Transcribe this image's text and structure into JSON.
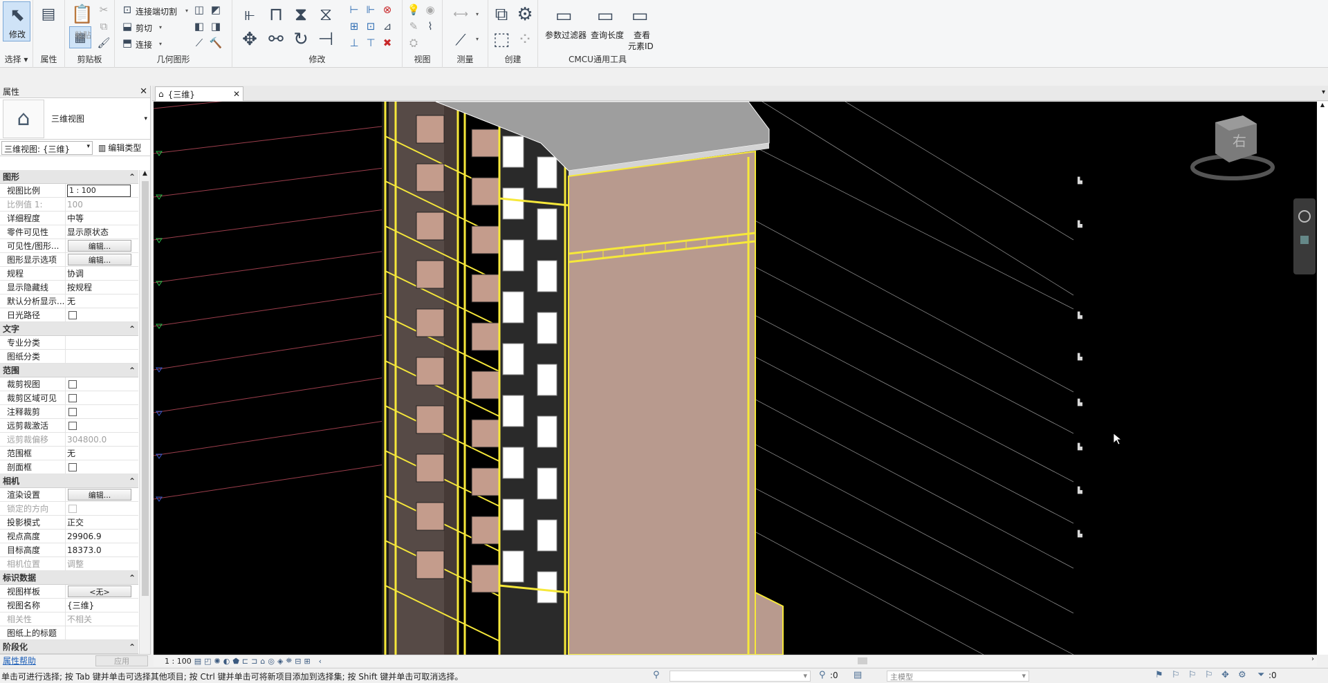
{
  "ribbon": {
    "groups": {
      "select": "选择",
      "properties": "属性",
      "clipboard": "剪贴板",
      "geometry": "几何图形",
      "modify": "修改",
      "view": "视图",
      "measure": "测量",
      "create": "创建",
      "cmcu": "CMCU通用工具"
    },
    "modify_label": "修改",
    "paste_label": "粘贴",
    "cope_label": "连接端切割",
    "cut_label": "剪切",
    "join_label": "连接",
    "param_filter": "参数过滤器",
    "query_length": "查询长度",
    "view_element_id_1": "查看",
    "view_element_id_2": "元素ID"
  },
  "properties": {
    "title": "属性",
    "type_name": "三维视图",
    "instance_selector": "三维视图: {三维}",
    "edit_type": "编辑类型",
    "help": "属性帮助",
    "apply": "应用",
    "cat_graphics": "图形",
    "cat_text": "文字",
    "cat_extents": "范围",
    "cat_camera": "相机",
    "cat_identity": "标识数据",
    "cat_phasing": "阶段化",
    "rows": {
      "view_scale": {
        "name": "视图比例",
        "value": "1 : 100"
      },
      "scale_value": {
        "name": "比例值 1:",
        "value": "100"
      },
      "detail_level": {
        "name": "详细程度",
        "value": "中等"
      },
      "parts_visibility": {
        "name": "零件可见性",
        "value": "显示原状态"
      },
      "vg_overrides": {
        "name": "可见性/图形...",
        "value": "编辑..."
      },
      "graphic_display": {
        "name": "图形显示选项",
        "value": "编辑..."
      },
      "discipline": {
        "name": "规程",
        "value": "协调"
      },
      "hidden_lines": {
        "name": "显示隐藏线",
        "value": "按规程"
      },
      "analysis_display": {
        "name": "默认分析显示...",
        "value": "无"
      },
      "sun_path": {
        "name": "日光路径",
        "value": ""
      },
      "discipline_cat": {
        "name": "专业分类",
        "value": ""
      },
      "sheet_cat": {
        "name": "图纸分类",
        "value": ""
      },
      "crop_view": {
        "name": "裁剪视图",
        "value": ""
      },
      "crop_visible": {
        "name": "裁剪区域可见",
        "value": ""
      },
      "annotation_crop": {
        "name": "注释裁剪",
        "value": ""
      },
      "far_clip_active": {
        "name": "远剪裁激活",
        "value": ""
      },
      "far_clip_offset": {
        "name": "远剪裁偏移",
        "value": "304800.0"
      },
      "scope_box": {
        "name": "范围框",
        "value": "无"
      },
      "section_box": {
        "name": "剖面框",
        "value": ""
      },
      "render_settings": {
        "name": "渲染设置",
        "value": "编辑..."
      },
      "locked_orientation": {
        "name": "锁定的方向",
        "value": ""
      },
      "projection_mode": {
        "name": "投影模式",
        "value": "正交"
      },
      "eye_elevation": {
        "name": "视点高度",
        "value": "29906.9"
      },
      "target_elevation": {
        "name": "目标高度",
        "value": "18373.0"
      },
      "camera_position": {
        "name": "相机位置",
        "value": "调整"
      },
      "view_template": {
        "name": "视图样板",
        "value": "<无>"
      },
      "view_name": {
        "name": "视图名称",
        "value": "{三维}"
      },
      "dependency": {
        "name": "相关性",
        "value": "不相关"
      },
      "title_on_sheet": {
        "name": "图纸上的标题",
        "value": ""
      }
    }
  },
  "view_tab": {
    "label": "{三维}"
  },
  "view_control": {
    "scale": "1 : 100"
  },
  "viewcube": {
    "face": "右"
  },
  "status": {
    "message": "单击可进行选择; 按 Tab 键并单击可选择其他项目; 按 Ctrl 键并单击可将新项目添加到选择集; 按 Shift 键并单击可取消选择。",
    "worksets": ":0",
    "model": "主模型",
    "filter_count": ":0"
  }
}
